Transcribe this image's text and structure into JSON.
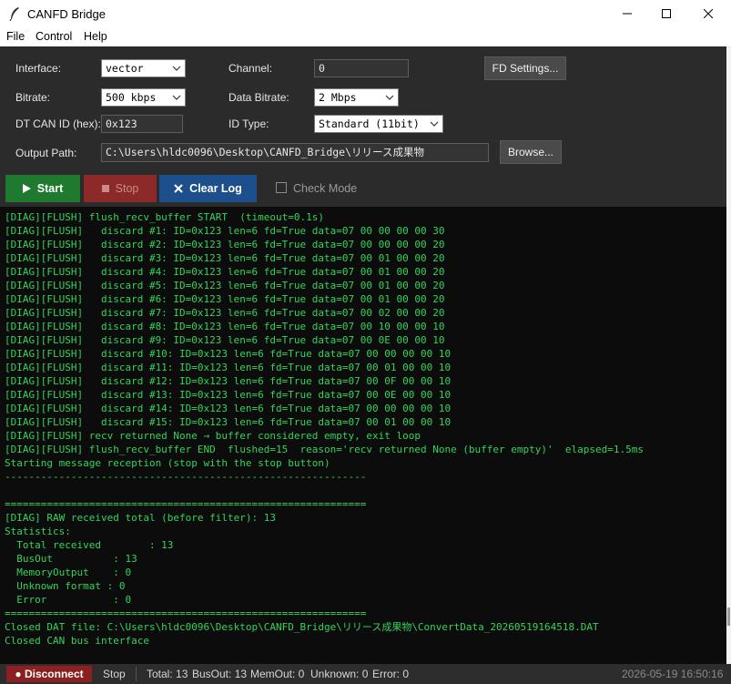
{
  "window": {
    "title": "CANFD Bridge"
  },
  "menu": {
    "items": [
      "File",
      "Control",
      "Help"
    ]
  },
  "form": {
    "interface_label": "Interface:",
    "interface_value": "vector",
    "channel_label": "Channel:",
    "channel_value": "0",
    "fd_settings_label": "FD Settings...",
    "bitrate_label": "Bitrate:",
    "bitrate_value": "500 kbps",
    "data_bitrate_label": "Data Bitrate:",
    "data_bitrate_value": "2 Mbps",
    "dt_id_label": "DT CAN ID (hex):",
    "dt_id_value": "0x123",
    "id_type_label": "ID Type:",
    "id_type_value": "Standard (11bit)",
    "output_label": "Output Path:",
    "output_value": "C:\\Users\\hldc0096\\Desktop\\CANFD_Bridge\\リリース成果物",
    "browse_label": "Browse..."
  },
  "actions": {
    "start_label": "Start",
    "stop_label": "Stop",
    "clear_label": "Clear Log",
    "check_mode_label": "Check Mode"
  },
  "log": {
    "lines": [
      "[DIAG][FLUSH] flush_recv_buffer START  (timeout=0.1s)",
      "[DIAG][FLUSH]   discard #1: ID=0x123 len=6 fd=True data=07 00 00 00 00 30",
      "[DIAG][FLUSH]   discard #2: ID=0x123 len=6 fd=True data=07 00 00 00 00 20",
      "[DIAG][FLUSH]   discard #3: ID=0x123 len=6 fd=True data=07 00 01 00 00 20",
      "[DIAG][FLUSH]   discard #4: ID=0x123 len=6 fd=True data=07 00 01 00 00 20",
      "[DIAG][FLUSH]   discard #5: ID=0x123 len=6 fd=True data=07 00 01 00 00 20",
      "[DIAG][FLUSH]   discard #6: ID=0x123 len=6 fd=True data=07 00 01 00 00 20",
      "[DIAG][FLUSH]   discard #7: ID=0x123 len=6 fd=True data=07 00 02 00 00 20",
      "[DIAG][FLUSH]   discard #8: ID=0x123 len=6 fd=True data=07 00 10 00 00 10",
      "[DIAG][FLUSH]   discard #9: ID=0x123 len=6 fd=True data=07 00 0E 00 00 10",
      "[DIAG][FLUSH]   discard #10: ID=0x123 len=6 fd=True data=07 00 00 00 00 10",
      "[DIAG][FLUSH]   discard #11: ID=0x123 len=6 fd=True data=07 00 01 00 00 10",
      "[DIAG][FLUSH]   discard #12: ID=0x123 len=6 fd=True data=07 00 0F 00 00 10",
      "[DIAG][FLUSH]   discard #13: ID=0x123 len=6 fd=True data=07 00 0E 00 00 10",
      "[DIAG][FLUSH]   discard #14: ID=0x123 len=6 fd=True data=07 00 00 00 00 10",
      "[DIAG][FLUSH]   discard #15: ID=0x123 len=6 fd=True data=07 00 01 00 00 10",
      "[DIAG][FLUSH] recv returned None → buffer considered empty, exit loop",
      "[DIAG][FLUSH] flush_recv_buffer END  flushed=15  reason='recv returned None (buffer empty)'  elapsed=1.5ms",
      "Starting message reception (stop with the stop button)",
      "------------------------------------------------------------",
      "",
      "============================================================",
      "[DIAG] RAW received total (before filter): 13",
      "Statistics:",
      "  Total received        : 13",
      "  BusOut          : 13",
      "  MemoryOutput    : 0",
      "  Unknown format : 0",
      "  Error           : 0",
      "============================================================",
      "Closed DAT file: C:\\Users\\hldc0096\\Desktop\\CANFD_Bridge\\リリース成果物\\ConvertData_20260519164518.DAT",
      "Closed CAN bus interface"
    ]
  },
  "status": {
    "disconnect_label": "● Disconnect",
    "state": "Stop",
    "total": "Total: 13",
    "busout": "BusOut: 13",
    "memout": "MemOut: 0",
    "unknown": "Unknown: 0",
    "error": "Error: 0",
    "timestamp": "2026-05-19  16:50:16"
  },
  "colors": {
    "start": "#1f7a2f",
    "stop": "#8c2a2a",
    "clear": "#1d4f8c",
    "log_text": "#33d45a"
  },
  "icons": {
    "app": "feather-icon",
    "start": "play-icon",
    "stop": "stop-icon",
    "clear": "close-icon"
  }
}
